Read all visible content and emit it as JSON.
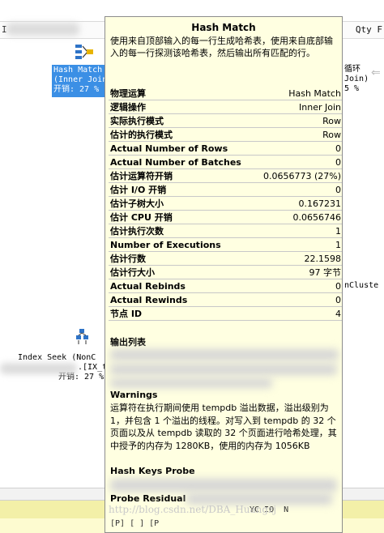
{
  "plan": {
    "header_right": "Qty F",
    "header_left": "I",
    "selected_node": {
      "name": "Hash Match",
      "sub": "(Inner Join)",
      "cost": "开销: 27 %"
    },
    "right_node": {
      "name": "循环",
      "sub": "Join)",
      "cost": "5 %"
    },
    "lower_right_fragment": "nCluste",
    "lower_node": {
      "name": "Index Seek (NonC",
      "sub": ".[IX_t",
      "cost": "开销: 27 %"
    }
  },
  "tooltip": {
    "title": "Hash Match",
    "description": "使用来自顶部输入的每一行生成哈希表，使用来自底部输入的每一行探测该哈希表，然后输出所有匹配的行。",
    "properties": [
      {
        "key": "物理运算",
        "value": "Hash Match"
      },
      {
        "key": "逻辑操作",
        "value": "Inner Join"
      },
      {
        "key": "实际执行模式",
        "value": "Row"
      },
      {
        "key": "估计的执行模式",
        "value": "Row"
      },
      {
        "key": "Actual Number of Rows",
        "value": "0"
      },
      {
        "key": "Actual Number of Batches",
        "value": "0"
      },
      {
        "key": "估计运算符开销",
        "value": "0.0656773 (27%)"
      },
      {
        "key": "估计 I/O 开销",
        "value": "0"
      },
      {
        "key": "估计子树大小",
        "value": "0.167231"
      },
      {
        "key": "估计 CPU 开销",
        "value": "0.0656746"
      },
      {
        "key": "估计执行次数",
        "value": "1"
      },
      {
        "key": "Number of Executions",
        "value": "1"
      },
      {
        "key": "估计行数",
        "value": "22.1598"
      },
      {
        "key": "估计行大小",
        "value": "97 字节"
      },
      {
        "key": "Actual Rebinds",
        "value": "0"
      },
      {
        "key": "Actual Rewinds",
        "value": "0"
      },
      {
        "key": "节点 ID",
        "value": "4"
      }
    ],
    "output_list_label": "输出列表",
    "warnings_label": "Warnings",
    "warnings_text": "运算符在执行期间使用 tempdb 溢出数据，溢出级别为 1，并包含 1 个溢出的线程。对写入到 tempdb 的 32 个页面以及从 tempdb 读取的 32 个页面进行哈希处理，其中授予的内存为 1280KB，使用的内存为 1056KB",
    "hash_keys_label": "Hash Keys Probe",
    "probe_residual_label": "Probe Residual",
    "probe_fragment_1": "YC IO  N",
    "probe_fragment_2": "[P] [ ] [P",
    "watermark": "http://blog.csdn.net/DBA_Huangzj"
  }
}
